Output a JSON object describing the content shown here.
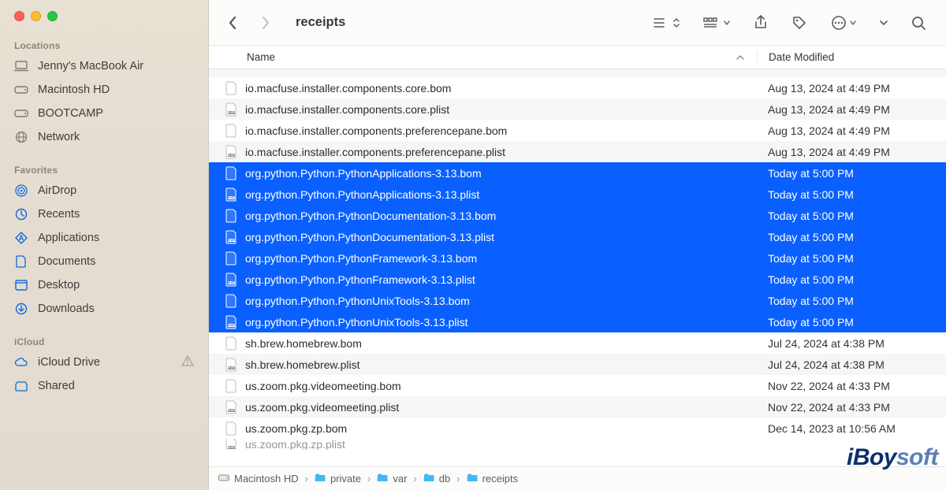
{
  "window": {
    "title": "receipts"
  },
  "sidebar": {
    "sections": {
      "locations": {
        "header": "Locations",
        "items": [
          {
            "label": "Jenny's MacBook Air",
            "icon": "laptop"
          },
          {
            "label": "Macintosh HD",
            "icon": "hdd"
          },
          {
            "label": "BOOTCAMP",
            "icon": "hdd"
          },
          {
            "label": "Network",
            "icon": "globe"
          }
        ]
      },
      "favorites": {
        "header": "Favorites",
        "items": [
          {
            "label": "AirDrop",
            "icon": "airdrop"
          },
          {
            "label": "Recents",
            "icon": "clock"
          },
          {
            "label": "Applications",
            "icon": "apps"
          },
          {
            "label": "Documents",
            "icon": "doc"
          },
          {
            "label": "Desktop",
            "icon": "desktop"
          },
          {
            "label": "Downloads",
            "icon": "download"
          }
        ]
      },
      "icloud": {
        "header": "iCloud",
        "items": [
          {
            "label": "iCloud Drive",
            "icon": "cloud",
            "warn": true
          },
          {
            "label": "Shared",
            "icon": "shared"
          }
        ]
      }
    }
  },
  "columns": {
    "name": "Name",
    "date": "Date Modified"
  },
  "files": [
    {
      "name": "io.macfuse.installer.components.core.bom",
      "date": "Aug 13, 2024 at 4:49 PM",
      "type": "bom",
      "selected": false
    },
    {
      "name": "io.macfuse.installer.components.core.plist",
      "date": "Aug 13, 2024 at 4:49 PM",
      "type": "plist",
      "selected": false
    },
    {
      "name": "io.macfuse.installer.components.preferencepane.bom",
      "date": "Aug 13, 2024 at 4:49 PM",
      "type": "bom",
      "selected": false
    },
    {
      "name": "io.macfuse.installer.components.preferencepane.plist",
      "date": "Aug 13, 2024 at 4:49 PM",
      "type": "plist",
      "selected": false
    },
    {
      "name": "org.python.Python.PythonApplications-3.13.bom",
      "date": "Today at 5:00 PM",
      "type": "bom",
      "selected": true
    },
    {
      "name": "org.python.Python.PythonApplications-3.13.plist",
      "date": "Today at 5:00 PM",
      "type": "plist",
      "selected": true
    },
    {
      "name": "org.python.Python.PythonDocumentation-3.13.bom",
      "date": "Today at 5:00 PM",
      "type": "bom",
      "selected": true
    },
    {
      "name": "org.python.Python.PythonDocumentation-3.13.plist",
      "date": "Today at 5:00 PM",
      "type": "plist",
      "selected": true
    },
    {
      "name": "org.python.Python.PythonFramework-3.13.bom",
      "date": "Today at 5:00 PM",
      "type": "bom",
      "selected": true
    },
    {
      "name": "org.python.Python.PythonFramework-3.13.plist",
      "date": "Today at 5:00 PM",
      "type": "plist",
      "selected": true
    },
    {
      "name": "org.python.Python.PythonUnixTools-3.13.bom",
      "date": "Today at 5:00 PM",
      "type": "bom",
      "selected": true
    },
    {
      "name": "org.python.Python.PythonUnixTools-3.13.plist",
      "date": "Today at 5:00 PM",
      "type": "plist",
      "selected": true
    },
    {
      "name": "sh.brew.homebrew.bom",
      "date": "Jul 24, 2024 at 4:38 PM",
      "type": "bom",
      "selected": false
    },
    {
      "name": "sh.brew.homebrew.plist",
      "date": "Jul 24, 2024 at 4:38 PM",
      "type": "plist",
      "selected": false
    },
    {
      "name": "us.zoom.pkg.videomeeting.bom",
      "date": "Nov 22, 2024 at 4:33 PM",
      "type": "bom",
      "selected": false
    },
    {
      "name": "us.zoom.pkg.videomeeting.plist",
      "date": "Nov 22, 2024 at 4:33 PM",
      "type": "plist",
      "selected": false
    },
    {
      "name": "us.zoom.pkg.zp.bom",
      "date": "Dec 14, 2023 at 10:56 AM",
      "type": "bom",
      "selected": false
    }
  ],
  "pathbar": [
    "Macintosh HD",
    "private",
    "var",
    "db",
    "receipts"
  ],
  "watermark": {
    "bold": "iBoy",
    "light": "soft"
  }
}
